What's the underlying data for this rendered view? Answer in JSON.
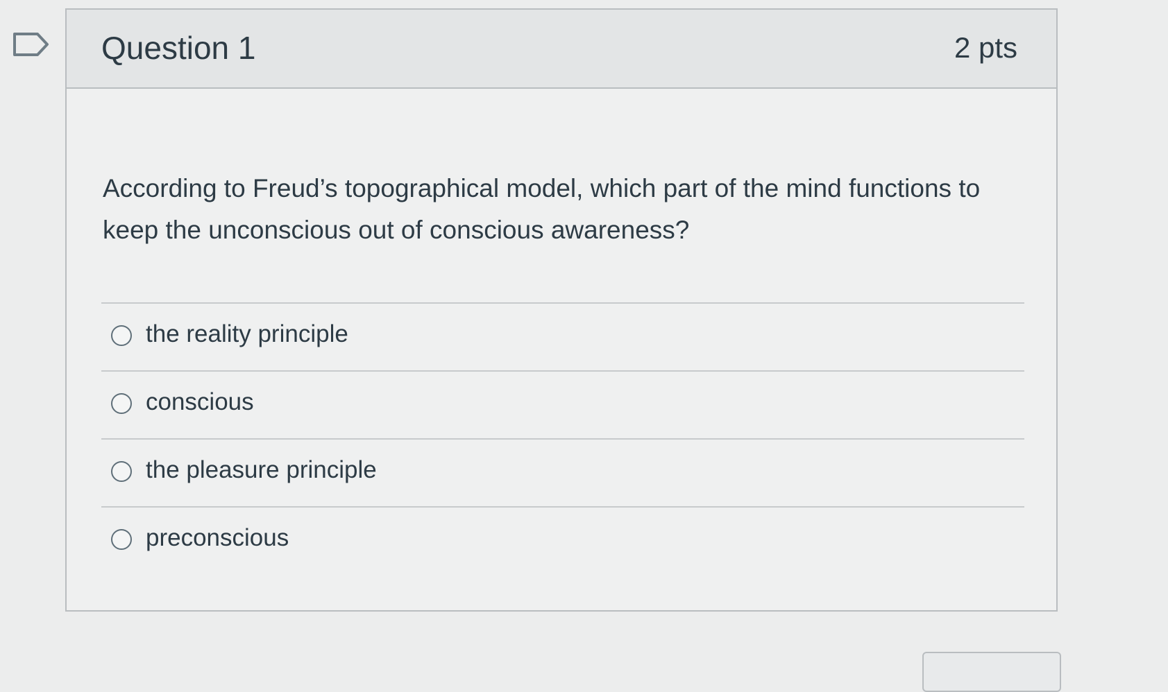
{
  "question": {
    "title": "Question 1",
    "points": "2 pts",
    "text": "According to Freud’s topographical model, which part of the mind functions to keep the unconscious out of conscious awareness?"
  },
  "answers": [
    {
      "label": "the reality principle"
    },
    {
      "label": "conscious"
    },
    {
      "label": "the pleasure principle"
    },
    {
      "label": "preconscious"
    }
  ],
  "icons": {
    "flag": "flag-question-icon",
    "answer_selector": "radio-circle"
  },
  "colors": {
    "page_background": "#eceded",
    "card_background": "#eff0f0",
    "header_background": "#e3e5e6",
    "text": "#2d3b45",
    "border": "#b9bdc0"
  }
}
